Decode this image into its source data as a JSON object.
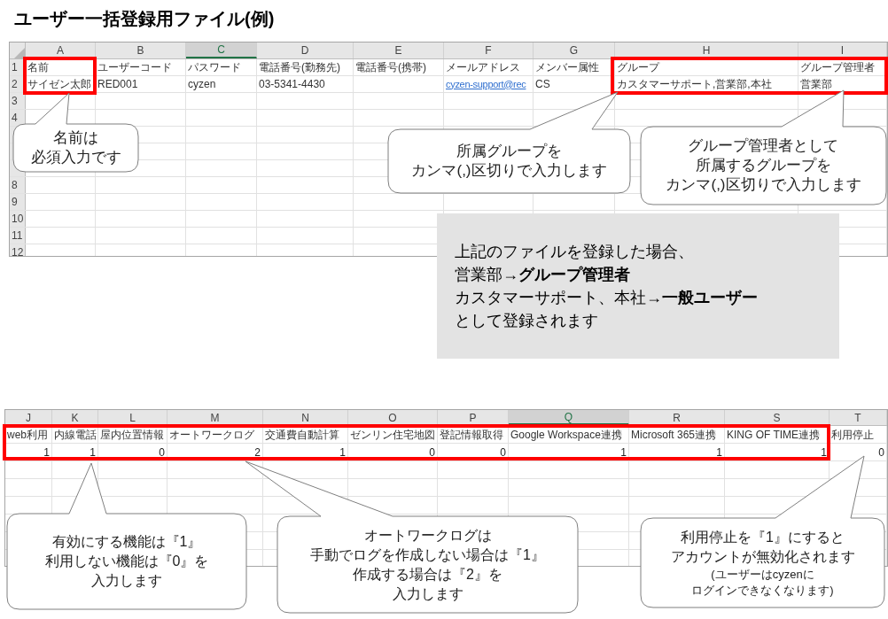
{
  "title": "ユーザー一括登録用ファイル(例)",
  "sheets": [
    {
      "columns": [
        {
          "letter": "A",
          "selected": false
        },
        {
          "letter": "B",
          "selected": false
        },
        {
          "letter": "C",
          "selected": true
        },
        {
          "letter": "D",
          "selected": false
        },
        {
          "letter": "E",
          "selected": false
        },
        {
          "letter": "F",
          "selected": false
        },
        {
          "letter": "G",
          "selected": false
        },
        {
          "letter": "H",
          "selected": false
        },
        {
          "letter": "I",
          "selected": false
        }
      ],
      "rows": [
        {
          "number": "1",
          "cells": [
            {
              "text": "名前"
            },
            {
              "text": "ユーザーコード"
            },
            {
              "text": "パスワード"
            },
            {
              "text": "電話番号(勤務先)"
            },
            {
              "text": "電話番号(携帯)"
            },
            {
              "text": "メールアドレス"
            },
            {
              "text": "メンバー属性"
            },
            {
              "text": "グループ"
            },
            {
              "text": "グループ管理者"
            }
          ]
        },
        {
          "number": "2",
          "cells": [
            {
              "text": "サイゼン太郎"
            },
            {
              "text": "RED001"
            },
            {
              "text": "cyzen"
            },
            {
              "text": "03-5341-4430"
            },
            null,
            {
              "text": "cyzen-support@rec",
              "kind": "link"
            },
            {
              "text": "CS"
            },
            {
              "text": "カスタマーサポート,営業部,本社"
            },
            {
              "text": "営業部"
            }
          ]
        },
        {
          "number": "3"
        },
        {
          "number": "4"
        },
        {},
        {},
        {},
        {
          "number": "8"
        },
        {
          "number": "9"
        },
        {
          "number": "10"
        },
        {
          "number": "11"
        },
        {
          "number": "12"
        }
      ]
    },
    {
      "columns": [
        {
          "letter": "J",
          "selected": false
        },
        {
          "letter": "K",
          "selected": false
        },
        {
          "letter": "L",
          "selected": false
        },
        {
          "letter": "M",
          "selected": false
        },
        {
          "letter": "N",
          "selected": false
        },
        {
          "letter": "O",
          "selected": false
        },
        {
          "letter": "P",
          "selected": false
        },
        {
          "letter": "Q",
          "selected": true
        },
        {
          "letter": "R",
          "selected": false
        },
        {
          "letter": "S",
          "selected": false
        },
        {
          "letter": "T",
          "selected": false
        }
      ],
      "rows": [
        {
          "cells": [
            {
              "text": "web利用"
            },
            {
              "text": "内線電話"
            },
            {
              "text": "屋内位置情報"
            },
            {
              "text": "オートワークログ"
            },
            {
              "text": "交通費自動計算"
            },
            {
              "text": "ゼンリン住宅地図"
            },
            {
              "text": "登記情報取得"
            },
            {
              "text": "Google Workspace連携"
            },
            {
              "text": "Microsoft 365連携"
            },
            {
              "text": "KING OF TIME連携"
            },
            {
              "text": "利用停止"
            }
          ]
        },
        {
          "cells": [
            {
              "text": "1",
              "kind": "number"
            },
            {
              "text": "1",
              "kind": "number"
            },
            {
              "text": "0",
              "kind": "number"
            },
            {
              "text": "2",
              "kind": "number"
            },
            {
              "text": "1",
              "kind": "number"
            },
            {
              "text": "0",
              "kind": "number"
            },
            {
              "text": "0",
              "kind": "number"
            },
            {
              "text": "1",
              "kind": "number"
            },
            {
              "text": "1",
              "kind": "number"
            },
            {
              "text": "1",
              "kind": "number"
            },
            {
              "text": "0",
              "kind": "number"
            }
          ]
        }
      ]
    }
  ],
  "info_box": {
    "lines": [
      "上記のファイルを登録した場合、",
      "営業部→**グループ管理者**",
      "カスタマーサポート、本社→**一般ユーザー**",
      "として登録されます"
    ]
  },
  "callouts": [
    {
      "lines": [
        "名前は",
        "必須入力です"
      ]
    },
    {
      "lines": [
        "所属グループを",
        "カンマ(,)区切りで入力します"
      ]
    },
    {
      "lines": [
        "グループ管理者として",
        "所属するグループを",
        "カンマ(,)区切りで入力します"
      ]
    },
    {
      "lines": [
        "有効にする機能は『1』",
        "利用しない機能は『0』を",
        "入力します"
      ]
    },
    {
      "lines": [
        "オートワークログは",
        "手動でログを作成しない場合は『1』",
        "作成する場合は『2』を",
        "入力します"
      ]
    },
    {
      "lines": [
        "利用停止を『1』にすると",
        "アカウントが無効化されます"
      ],
      "note": [
        "(ユーザーはcyzenに",
        "ログインできなくなります)"
      ]
    }
  ]
}
